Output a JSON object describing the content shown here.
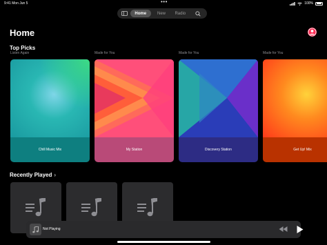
{
  "status_bar": {
    "time": "9:41 Mon Jun 5",
    "battery": "100%",
    "dots": "•••"
  },
  "nav": {
    "sidebar_icon": "sidebar-icon",
    "tabs": [
      {
        "label": "Home",
        "selected": true
      },
      {
        "label": "New",
        "selected": false
      },
      {
        "label": "Radio",
        "selected": false
      }
    ],
    "search_icon": "search-icon"
  },
  "page": {
    "title": "Home",
    "account_icon": "person-circle-icon"
  },
  "top_picks": {
    "title": "Top Picks",
    "cards": [
      {
        "caption": "Listen Again",
        "title": "Chill Music Mix"
      },
      {
        "caption": "Made for You",
        "title": "My Station"
      },
      {
        "caption": "Made for You",
        "title": "Discovery Station"
      },
      {
        "caption": "Made for You",
        "title": "Get Up! Mix"
      }
    ]
  },
  "recently_played": {
    "title": "Recently Played",
    "chevron": "›",
    "tile_icon": "music-note-list-icon"
  },
  "mini_player": {
    "title": "Not Playing",
    "art_icon": "music-note-icon",
    "rewind_icon": "backward-icon",
    "play_icon": "play-icon"
  },
  "colors": {
    "accent": "#ff2d55",
    "background": "#000000"
  }
}
